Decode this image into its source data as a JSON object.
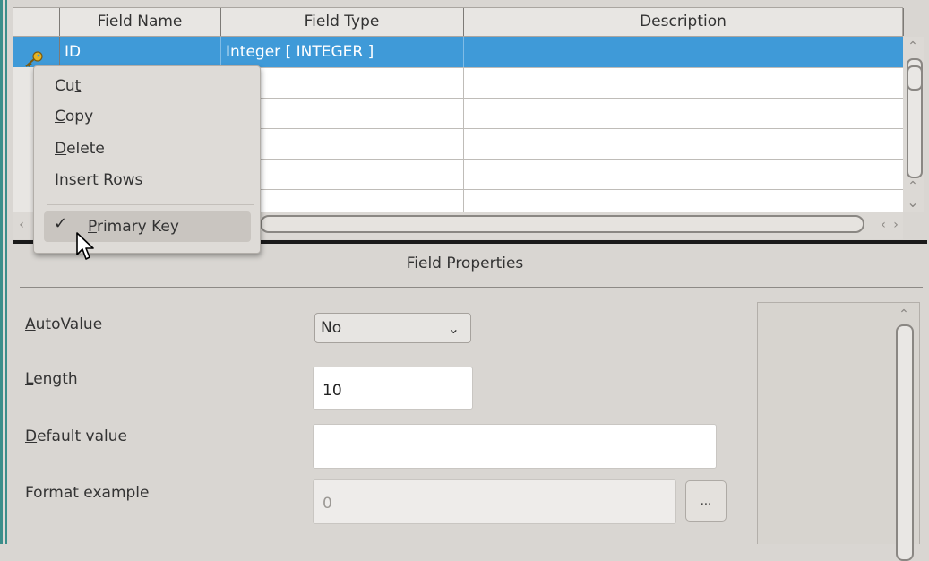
{
  "grid": {
    "columns": [
      "Field Name",
      "Field Type",
      "Description"
    ],
    "rows": [
      {
        "field_name": "ID",
        "field_type": "Integer [ INTEGER ]",
        "description": "",
        "primary_key": true
      }
    ]
  },
  "context_menu": {
    "items": [
      {
        "label": "Cut",
        "accel": "t"
      },
      {
        "label": "Copy",
        "accel": "C"
      },
      {
        "label": "Delete",
        "accel": "D"
      },
      {
        "label": "Insert Rows",
        "accel": "I"
      }
    ],
    "primary_key": {
      "label": "Primary Key",
      "checked": true
    }
  },
  "field_properties": {
    "title": "Field Properties",
    "autovalue": {
      "label": "AutoValue",
      "value": "No"
    },
    "length": {
      "label": "Length",
      "value": "10"
    },
    "default_value": {
      "label": "Default value",
      "value": ""
    },
    "format_example": {
      "label": "Format example",
      "value": "0",
      "button": "..."
    }
  },
  "colors": {
    "selection": "#3f9ad8",
    "accent": "#3b8e8a"
  }
}
